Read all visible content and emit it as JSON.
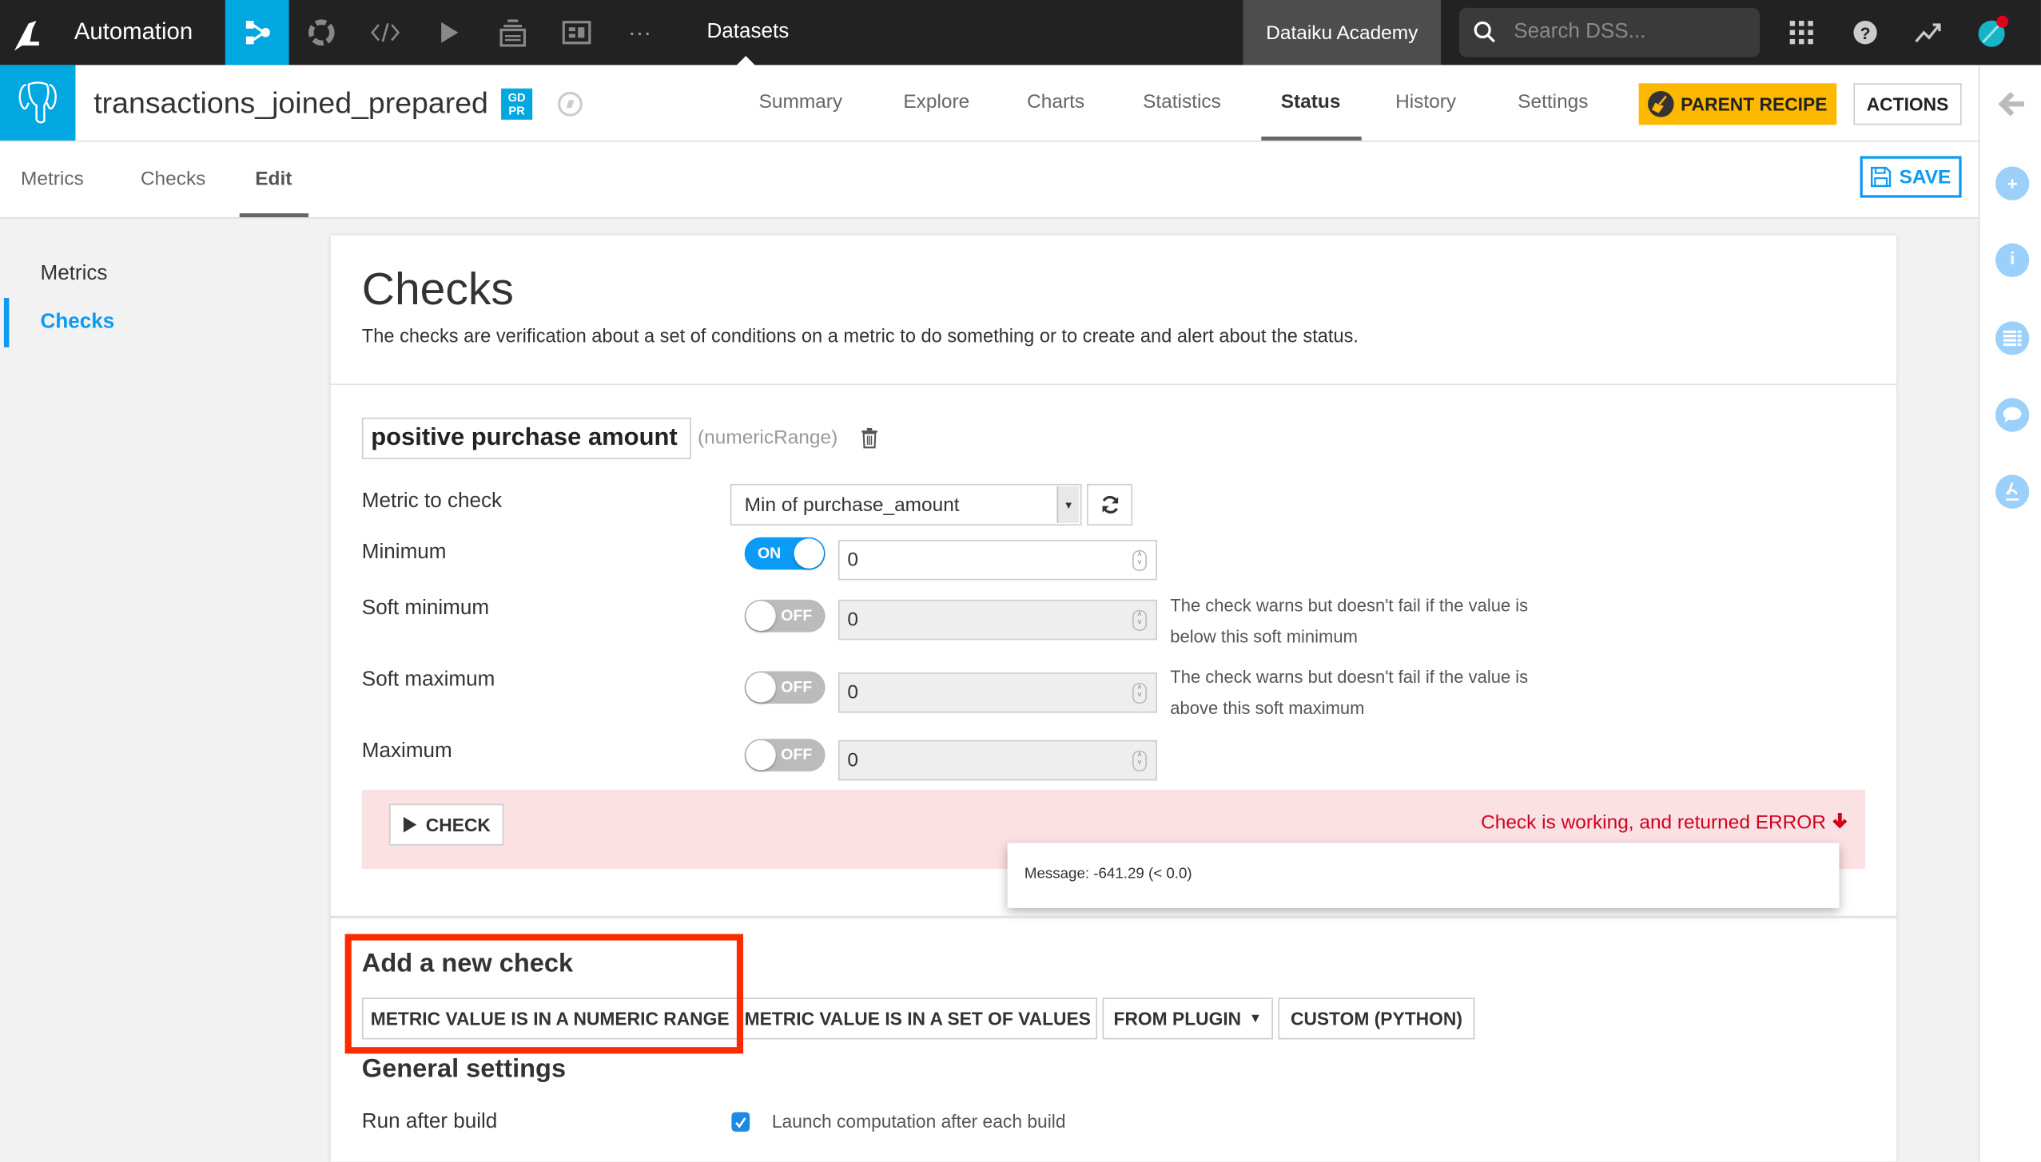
{
  "topnav": {
    "app_name": "Automation",
    "icons": [
      "flow-icon",
      "jobs-icon",
      "code-icon",
      "run-icon",
      "deploy-icon",
      "dashboard-icon",
      "more-icon"
    ],
    "more_label": "···",
    "current_section": "Datasets",
    "instance_name": "Dataiku Academy",
    "search_placeholder": "Search DSS...",
    "right_icons": [
      "apps-grid-icon",
      "help-icon",
      "activity-icon",
      "user-avatar"
    ]
  },
  "dataset": {
    "name": "transactions_joined_prepared",
    "badge": "GD PR",
    "badge_line1": "GD",
    "badge_line2": "PR",
    "tabs": [
      {
        "label": "Summary",
        "active": false
      },
      {
        "label": "Explore",
        "active": false
      },
      {
        "label": "Charts",
        "active": false
      },
      {
        "label": "Statistics",
        "active": false
      },
      {
        "label": "Status",
        "active": true
      },
      {
        "label": "History",
        "active": false
      },
      {
        "label": "Settings",
        "active": false
      }
    ],
    "parent_recipe_label": "PARENT RECIPE",
    "actions_label": "ACTIONS"
  },
  "subtabs": {
    "items": [
      {
        "label": "Metrics",
        "active": false
      },
      {
        "label": "Checks",
        "active": false
      },
      {
        "label": "Edit",
        "active": true
      }
    ],
    "save_label": "SAVE"
  },
  "leftnav": {
    "items": [
      {
        "label": "Metrics",
        "active": false
      },
      {
        "label": "Checks",
        "active": true
      }
    ]
  },
  "card": {
    "title": "Checks",
    "description": "The checks are verification about a set of conditions on a metric to do something or to create and alert about the status.",
    "check": {
      "name": "positive purchase amount",
      "type": "(numericRange)",
      "metric_label": "Metric to check",
      "metric_value": "Min of purchase_amount",
      "fields": [
        {
          "label": "Minimum",
          "enabled": true,
          "toggle_label": "ON",
          "value": "0",
          "hint": ""
        },
        {
          "label": "Soft minimum",
          "enabled": false,
          "toggle_label": "OFF",
          "value": "0",
          "hint": "The check warns but doesn't fail if the value is below this soft minimum"
        },
        {
          "label": "Soft maximum",
          "enabled": false,
          "toggle_label": "OFF",
          "value": "0",
          "hint": "The check warns but doesn't fail if the value is above this soft maximum"
        },
        {
          "label": "Maximum",
          "enabled": false,
          "toggle_label": "OFF",
          "value": "0",
          "hint": ""
        }
      ],
      "check_button_label": "CHECK",
      "result_text": "Check is working, and returned ERROR",
      "result_color": "#d0021b",
      "tooltip_message": "Message: -641.29 (< 0.0)"
    },
    "add_section": {
      "title": "Add a new check",
      "buttons": [
        {
          "label": "METRIC VALUE IS IN A NUMERIC RANGE",
          "dropdown": false
        },
        {
          "label": "METRIC VALUE IS IN A SET OF VALUES",
          "dropdown": false
        },
        {
          "label": "FROM PLUGIN",
          "dropdown": true
        },
        {
          "label": "CUSTOM (PYTHON)",
          "dropdown": false
        }
      ]
    },
    "general_settings": {
      "title": "General settings",
      "run_after_build_label": "Run after build",
      "run_after_build_checked": true,
      "run_after_build_text": "Launch computation after each build"
    }
  },
  "rightbar": {
    "icons": [
      "back-arrow-icon",
      "add-icon",
      "info-icon",
      "details-icon",
      "discussion-icon",
      "lab-icon"
    ]
  },
  "colors": {
    "accent": "#00a7e1",
    "link_blue": "#0b9bf4",
    "parent_recipe": "#fdb900",
    "error_bg": "#fce1e4",
    "highlight_red": "#ff2a00"
  }
}
